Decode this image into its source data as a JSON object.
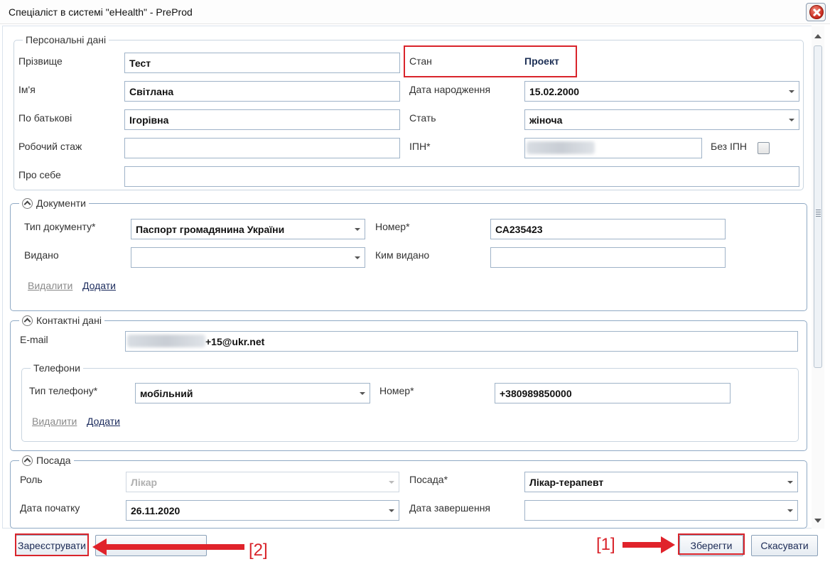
{
  "window": {
    "title": "Спеціаліст в системі \"eHealth\" - PreProd",
    "close_icon": "close-icon",
    "close_color": "#d9281c"
  },
  "personal": {
    "legend": "Персональні дані",
    "surname_label": "Прізвище",
    "surname_value": "Тест",
    "name_label": "Ім'я",
    "name_value": "Світлана",
    "patronymic_label": "По батькові",
    "patronymic_value": "Ігорівна",
    "experience_label": "Робочий стаж",
    "experience_value": "",
    "about_label": "Про себе",
    "about_value": "",
    "status_label": "Стан",
    "status_value": "Проект",
    "birthdate_label": "Дата народження",
    "birthdate_value": "15.02.2000",
    "gender_label": "Стать",
    "gender_value": "жіноча",
    "tax_id_label": "ІПН*",
    "no_tax_id_label": "Без ІПН",
    "no_tax_id_checked": false
  },
  "documents": {
    "legend": "Документи",
    "doc_type_label": "Тип документу*",
    "doc_type_value": "Паспорт громадянина України",
    "number_label": "Номер*",
    "number_value": "СА235423",
    "issued_label": "Видано",
    "issued_value": "",
    "issued_by_label": "Ким видано",
    "issued_by_value": "",
    "delete_link": "Видалити",
    "add_link": "Додати"
  },
  "contacts": {
    "legend": "Контактні дані",
    "email_label": "E-mail",
    "email_value_visible": "+15@ukr.net",
    "phones": {
      "legend": "Телефони",
      "phone_type_label": "Тип телефону*",
      "phone_type_value": "мобільний",
      "number_label": "Номер*",
      "number_value": "+380989850000",
      "delete_link": "Видалити",
      "add_link": "Додати"
    }
  },
  "position": {
    "legend": "Посада",
    "role_label": "Роль",
    "role_value": "Лікар",
    "position_label": "Посада*",
    "position_value": "Лікар-терапевт",
    "start_date_label": "Дата початку",
    "start_date_value": "26.11.2020",
    "end_date_label": "Дата завершення",
    "end_date_value": ""
  },
  "footer": {
    "register_button": "Зареєструвати",
    "second_button": "",
    "save_button": "Зберегти",
    "cancel_button": "Скасувати"
  },
  "annotations": {
    "label_1": "[1]",
    "label_2": "[2]",
    "color": "#d9242b"
  }
}
